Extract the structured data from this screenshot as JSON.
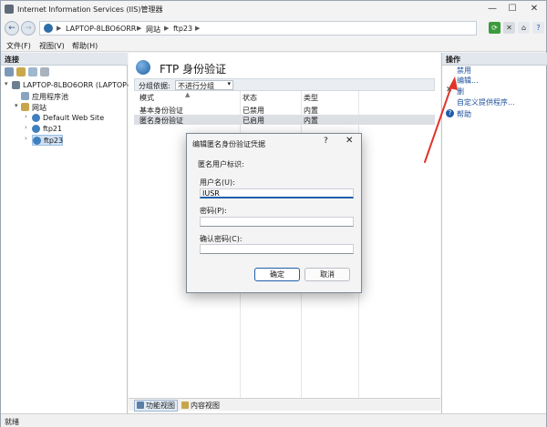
{
  "window": {
    "title": "Internet Information Services (IIS)管理器",
    "controls": {
      "minimize": "—",
      "maximize": "☐",
      "close": "✕"
    }
  },
  "address": {
    "back": "←",
    "forward": "→",
    "crumbs": [
      "LAPTOP-8LBO6ORR",
      "网站",
      "ftp23"
    ],
    "separator": "▶"
  },
  "menu": {
    "items": [
      "文件(F)",
      "视图(V)",
      "帮助(H)"
    ]
  },
  "left_pane": {
    "header": "连接",
    "tree": [
      {
        "label": "LAPTOP-8LBO6ORR (LAPTOP-8LB",
        "expander": "▾"
      },
      {
        "label": "应用程序池",
        "expander": ""
      },
      {
        "label": "网站",
        "expander": "▾"
      },
      {
        "label": "Default Web Site",
        "expander": "›"
      },
      {
        "label": "ftp21",
        "expander": "›"
      },
      {
        "label": "ftp23",
        "expander": "›"
      }
    ]
  },
  "center": {
    "title": "FTP 身份验证",
    "group_label": "分组依据:",
    "group_value": "不进行分组",
    "columns": [
      "模式",
      "状态",
      "类型"
    ],
    "rows": [
      {
        "mode": "基本身份验证",
        "status": "已禁用",
        "type": "内置"
      },
      {
        "mode": "匿名身份验证",
        "status": "已启用",
        "type": "内置"
      }
    ],
    "tabs": [
      "功能视图",
      "内容视图"
    ]
  },
  "right_pane": {
    "header": "操作",
    "actions": [
      {
        "label": "禁用",
        "icon": ""
      },
      {
        "label": "编辑...",
        "icon": ""
      },
      {
        "label": "删",
        "icon": "✕"
      },
      {
        "label": "自定义提供程序...",
        "icon": ""
      },
      {
        "label": "帮助",
        "icon": "?"
      }
    ]
  },
  "status_bar": {
    "text": "就绪"
  },
  "dialog": {
    "title": "编辑匿名身份验证凭据",
    "help": "?",
    "close": "✕",
    "section_label": "匿名用户标识:",
    "username_label": "用户名(U):",
    "username_value": "IUSR",
    "password_label": "密码(P):",
    "confirm_label": "确认密码(C):",
    "ok_label": "确定",
    "cancel_label": "取消"
  },
  "colors": {
    "accent": "#1f5ea9",
    "link": "#1c4f9c",
    "annotation_arrow": "#e0342b"
  }
}
